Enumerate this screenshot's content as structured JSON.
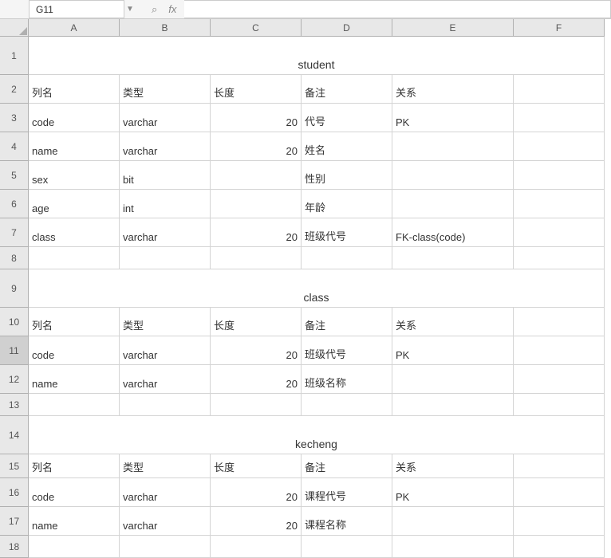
{
  "nameBox": "G11",
  "columns": [
    "A",
    "B",
    "C",
    "D",
    "E",
    "F"
  ],
  "rowHeaders": [
    "1",
    "2",
    "3",
    "4",
    "5",
    "6",
    "7",
    "8",
    "9",
    "10",
    "11",
    "12",
    "13",
    "14",
    "15",
    "16",
    "17",
    "18"
  ],
  "selectedRow": 11,
  "tables": {
    "student": {
      "title": "student",
      "headers": [
        "列名",
        "类型",
        "长度",
        "备注",
        "关系"
      ],
      "rows": [
        {
          "name": "code",
          "type": "varchar",
          "len": "20",
          "remark": "代号",
          "rel": "PK"
        },
        {
          "name": "name",
          "type": "varchar",
          "len": "20",
          "remark": "姓名",
          "rel": ""
        },
        {
          "name": "sex",
          "type": "bit",
          "len": "",
          "remark": "性别",
          "rel": ""
        },
        {
          "name": "age",
          "type": "int",
          "len": "",
          "remark": "年龄",
          "rel": ""
        },
        {
          "name": "class",
          "type": "varchar",
          "len": "20",
          "remark": "班级代号",
          "rel": "FK-class(code)"
        }
      ]
    },
    "classTbl": {
      "title": "class",
      "headers": [
        "列名",
        "类型",
        "长度",
        "备注",
        "关系"
      ],
      "rows": [
        {
          "name": "code",
          "type": "varchar",
          "len": "20",
          "remark": "班级代号",
          "rel": "PK"
        },
        {
          "name": "name",
          "type": "varchar",
          "len": "20",
          "remark": "班级名称",
          "rel": ""
        }
      ]
    },
    "kecheng": {
      "title": "kecheng",
      "headers": [
        "列名",
        "类型",
        "长度",
        "备注",
        "关系"
      ],
      "rows": [
        {
          "name": "code",
          "type": "varchar",
          "len": "20",
          "remark": "课程代号",
          "rel": "PK"
        },
        {
          "name": "name",
          "type": "varchar",
          "len": "20",
          "remark": "课程名称",
          "rel": ""
        }
      ]
    }
  }
}
